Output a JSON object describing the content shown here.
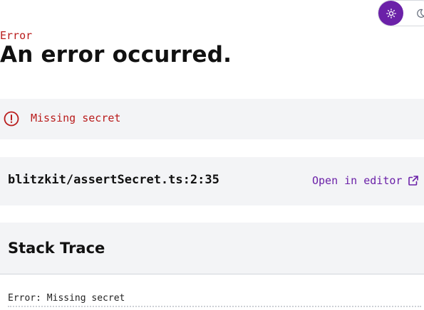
{
  "theme_toggle": {
    "active_icon": "sun-icon",
    "inactive_icon": "moon-icon",
    "accent_color": "#6b21a8"
  },
  "error": {
    "label": "Error",
    "title": "An error occurred.",
    "message": "Missing secret",
    "message_icon": "alert-circle-icon",
    "color": "#b91c1c"
  },
  "location": {
    "file": "blitzkit/assertSecret.ts:2:35",
    "open_label": "Open in editor",
    "open_icon": "external-link-icon"
  },
  "stack": {
    "heading": "Stack Trace",
    "first_line": "Error: Missing secret"
  }
}
